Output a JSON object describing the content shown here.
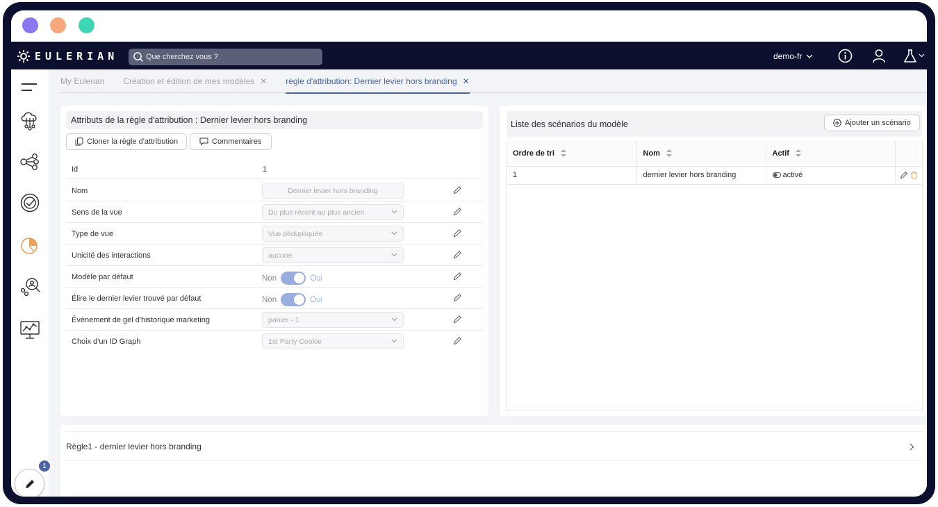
{
  "window": {
    "dot_colors": [
      "#8b78f0",
      "#f5a87e",
      "#3fd6b6"
    ]
  },
  "brand": {
    "name": "EULERIAN"
  },
  "search": {
    "placeholder": "Que cherchez vous ?"
  },
  "account": {
    "name": "demo-fr"
  },
  "icons": {
    "topnav": [
      "search-icon",
      "info-icon",
      "user-icon",
      "flask-icon",
      "chevron-down-icon"
    ],
    "sidebar": [
      "menu-icon",
      "cloud-data-icon",
      "network-icon",
      "target-check-icon",
      "pie-chart-icon",
      "magnifier-people-icon",
      "monitor-chart-icon",
      "pencil-icon"
    ]
  },
  "fab": {
    "badge": "1"
  },
  "tabs": [
    {
      "label": "My Eulerian",
      "closable": false,
      "active": false
    },
    {
      "label": "Création et édition de mes modèles",
      "closable": true,
      "active": false
    },
    {
      "label": "règle d'attribution: Dernier levier hors branding",
      "closable": true,
      "active": true
    }
  ],
  "left_panel": {
    "title": "Attributs de la règle d'attribution : Dernier levier hors branding",
    "clone_label": "Cloner la règle d'attribution",
    "comments_label": "Commentaires",
    "rows": {
      "id": {
        "label": "Id",
        "value": "1"
      },
      "nom": {
        "label": "Nom",
        "value": "Dernier levier hors branding"
      },
      "sens": {
        "label": "Sens de la vue",
        "value": "Du plus récent au plus ancien"
      },
      "type": {
        "label": "Type de vue",
        "value": "Vue dédupliquée"
      },
      "unicite": {
        "label": "Unicité des interactions",
        "value": "aucune"
      },
      "defaut": {
        "label": "Modèle par défaut",
        "off": "Non",
        "on": "Oui"
      },
      "elire": {
        "label": "Élire le dernier levier trouvé par défaut",
        "off": "Non",
        "on": "Oui"
      },
      "gel": {
        "label": "Évènement de gel d'historique marketing",
        "value": "panier - 1"
      },
      "graph": {
        "label": "Choix d'un ID Graph",
        "value": "1st Party Cookie"
      }
    }
  },
  "right_panel": {
    "title": "Liste des scénarios du modèle",
    "add_label": "Ajouter un scénario",
    "columns": [
      "Ordre de tri",
      "Nom",
      "Actif"
    ],
    "rows": [
      {
        "ordre": "1",
        "nom": "dernier levier hors branding",
        "actif": "activé"
      }
    ]
  },
  "bottom": {
    "rule_label": "Règle1 - dernier levier hors branding"
  },
  "colors": {
    "navy": "#0d0f2e",
    "accent": "#4b64a4",
    "toggle": "#9aaedd",
    "orange": "#e8a05c"
  }
}
